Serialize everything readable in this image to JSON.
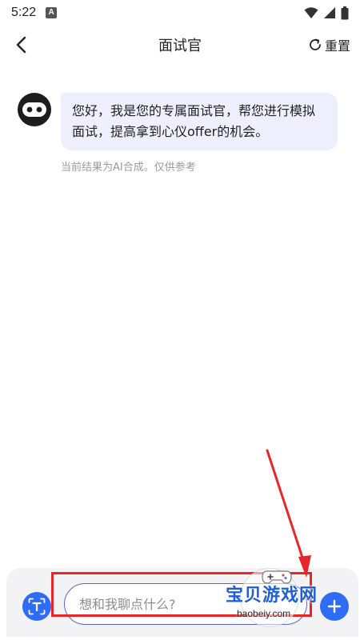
{
  "status_bar": {
    "time": "5:22",
    "app_icon_letter": "A"
  },
  "nav": {
    "title": "面试官",
    "reset_label": "重置"
  },
  "chat": {
    "messages": [
      {
        "role": "bot",
        "text": "您好，我是您的专属面试官，帮您进行模拟面试，提高拿到心仪offer的机会。"
      }
    ],
    "ai_note": "当前结果为AI合成。仅供参考"
  },
  "input": {
    "placeholder": "想和我聊点什么?",
    "value": ""
  },
  "watermark": {
    "text": "宝贝游戏网",
    "url": "baobeiy.com"
  },
  "colors": {
    "accent": "#2f6cf6",
    "bubble_bg": "#eeeefd",
    "highlight": "#e8262a"
  }
}
